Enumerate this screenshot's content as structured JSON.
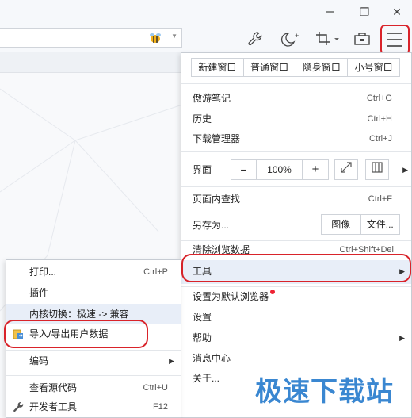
{
  "window": {
    "restore_glyph": "❐",
    "close_glyph": "✕"
  },
  "menu": {
    "window_buttons": [
      "新建窗口",
      "普通窗口",
      "隐身窗口",
      "小号窗口"
    ],
    "items": {
      "notes": {
        "label": "傲游笔记",
        "shortcut": "Ctrl+G"
      },
      "history": {
        "label": "历史",
        "shortcut": "Ctrl+H"
      },
      "downloads": {
        "label": "下载管理器",
        "shortcut": "Ctrl+J"
      },
      "interface": {
        "label": "界面"
      },
      "find": {
        "label": "页面内查找",
        "shortcut": "Ctrl+F"
      },
      "save_as": {
        "label": "另存为...",
        "image_btn": "图像",
        "file_btn": "文件..."
      },
      "clear_data": {
        "label": "清除浏览数据",
        "shortcut": "Ctrl+Shift+Del"
      },
      "tools": {
        "label": "工具"
      },
      "set_default": {
        "label": "设置为默认浏览器"
      },
      "settings": {
        "label": "设置"
      },
      "help": {
        "label": "帮助"
      },
      "messages": {
        "label": "消息中心"
      },
      "about": {
        "label": "关于..."
      }
    },
    "zoom": {
      "minus": "−",
      "value": "100%",
      "plus": "+"
    }
  },
  "submenu": {
    "print": {
      "label": "打印...",
      "shortcut": "Ctrl+P"
    },
    "plugins": {
      "label": "插件"
    },
    "core_switch": {
      "label": "内核切换：极速 -> 兼容"
    },
    "import_export": {
      "label": "导入/导出用户数据"
    },
    "encoding": {
      "label": "编码"
    },
    "view_source": {
      "label": "查看源代码",
      "shortcut": "Ctrl+U"
    },
    "dev_tools": {
      "label": "开发者工具",
      "shortcut": "F12"
    }
  },
  "watermark": "极速下载站",
  "colors": {
    "accent_red": "#d9232a",
    "watermark_blue": "#3a87d1",
    "highlight": "#e8eef8"
  }
}
